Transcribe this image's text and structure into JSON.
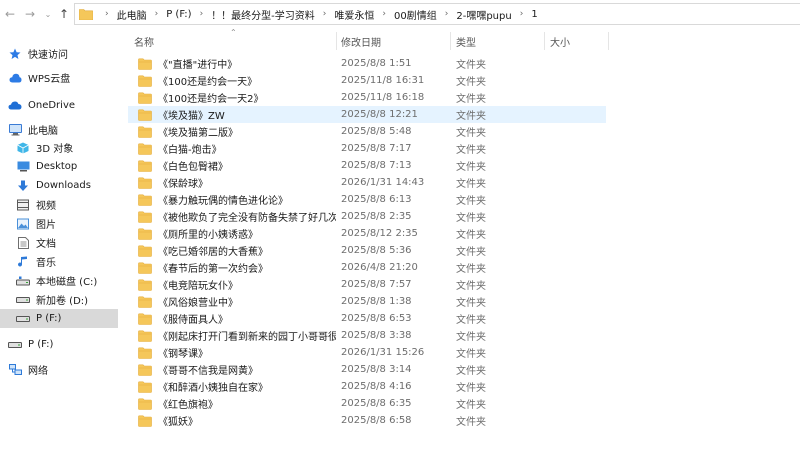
{
  "address": {
    "crumbs": [
      "此电脑",
      "P (F:)",
      "！！最终分型-学习资料",
      "唯爱永恒",
      "00剧情组",
      "2-嘿嘿pupu",
      "1"
    ]
  },
  "sidebar": {
    "items": [
      {
        "label": "快速访问",
        "icon": "star-icon",
        "color": "#2d7be5"
      },
      {
        "label": "WPS云盘",
        "icon": "cloud-icon",
        "color": "#2d7be5"
      },
      {
        "label": "OneDrive",
        "icon": "onedrive-icon",
        "color": "#1f6fd6"
      },
      {
        "label": "此电脑",
        "icon": "computer-icon",
        "color": "#3a7bd5"
      },
      {
        "label": "3D 对象",
        "icon": "cube-icon",
        "color": "#3fb6e8"
      },
      {
        "label": "Desktop",
        "icon": "desktop-icon",
        "color": "#3a8be0"
      },
      {
        "label": "Downloads",
        "icon": "download-icon",
        "color": "#2e7ad8"
      },
      {
        "label": "视频",
        "icon": "video-icon",
        "color": "#5a5a5a"
      },
      {
        "label": "图片",
        "icon": "picture-icon",
        "color": "#4a90d9"
      },
      {
        "label": "文档",
        "icon": "document-icon",
        "color": "#6f6f6f"
      },
      {
        "label": "音乐",
        "icon": "music-icon",
        "color": "#2e7ad8"
      },
      {
        "label": "本地磁盘 (C:)",
        "icon": "drive-c-icon",
        "color": "#555555"
      },
      {
        "label": "新加卷 (D:)",
        "icon": "drive-icon",
        "color": "#555555"
      },
      {
        "label": "P (F:)",
        "icon": "drive-icon",
        "color": "#555555"
      },
      {
        "label": "P (F:)",
        "icon": "drive-icon",
        "color": "#555555"
      },
      {
        "label": "网络",
        "icon": "network-icon",
        "color": "#2e7ad8"
      }
    ],
    "selected_index": 13
  },
  "columns": {
    "name": "名称",
    "date": "修改日期",
    "type": "类型",
    "size": "大小"
  },
  "files": [
    {
      "name": "《\"直播\"进行中》",
      "date": "2025/8/8 1:51",
      "type": "文件夹"
    },
    {
      "name": "《100还是约会一天》",
      "date": "2025/11/8 16:31",
      "type": "文件夹"
    },
    {
      "name": "《100还是约会一天2》",
      "date": "2025/11/8 16:18",
      "type": "文件夹"
    },
    {
      "name": "《埃及猫》ZW",
      "date": "2025/8/8 12:21",
      "type": "文件夹"
    },
    {
      "name": "《埃及猫第二版》",
      "date": "2025/8/8 5:48",
      "type": "文件夹"
    },
    {
      "name": "《白猫-炮击》",
      "date": "2025/8/8 7:17",
      "type": "文件夹"
    },
    {
      "name": "《白色包臀裙》",
      "date": "2025/8/8 7:13",
      "type": "文件夹"
    },
    {
      "name": "《保龄球》",
      "date": "2026/1/31 14:43",
      "type": "文件夹"
    },
    {
      "name": "《暴力触玩偶的情色进化论》",
      "date": "2025/8/8 6:13",
      "type": "文件夹"
    },
    {
      "name": "《被他欺负了完全没有防备失禁了好几次…",
      "date": "2025/8/8 2:35",
      "type": "文件夹"
    },
    {
      "name": "《厕所里的小姨诱惑》",
      "date": "2025/8/12 2:35",
      "type": "文件夹"
    },
    {
      "name": "《吃已婚邻居的大香蕉》",
      "date": "2025/8/8 5:36",
      "type": "文件夹"
    },
    {
      "name": "《春节后的第一次约会》",
      "date": "2026/4/8 21:20",
      "type": "文件夹"
    },
    {
      "name": "《电竞陪玩女仆》",
      "date": "2025/8/8 7:57",
      "type": "文件夹"
    },
    {
      "name": "《风俗娘营业中》",
      "date": "2025/8/8 1:38",
      "type": "文件夹"
    },
    {
      "name": "《服侍面具人》",
      "date": "2025/8/8 6:53",
      "type": "文件夹"
    },
    {
      "name": "《刚起床打开门看到新来的园丁小哥哥很…",
      "date": "2025/8/8 3:38",
      "type": "文件夹"
    },
    {
      "name": "《钢琴课》",
      "date": "2026/1/31 15:26",
      "type": "文件夹"
    },
    {
      "name": "《哥哥不信我是网黄》",
      "date": "2025/8/8 3:14",
      "type": "文件夹"
    },
    {
      "name": "《和醉酒小姨独自在家》",
      "date": "2025/8/8 4:16",
      "type": "文件夹"
    },
    {
      "name": "《红色旗袍》",
      "date": "2025/8/8 6:35",
      "type": "文件夹"
    },
    {
      "name": "《狐妖》",
      "date": "2025/8/8 6:58",
      "type": "文件夹"
    }
  ],
  "hover_index": 3,
  "colors": {
    "folder": "#f5c75a",
    "folder_dark": "#e5ad3a",
    "hover": "#e5f3ff",
    "selected": "#d9d9d9"
  }
}
